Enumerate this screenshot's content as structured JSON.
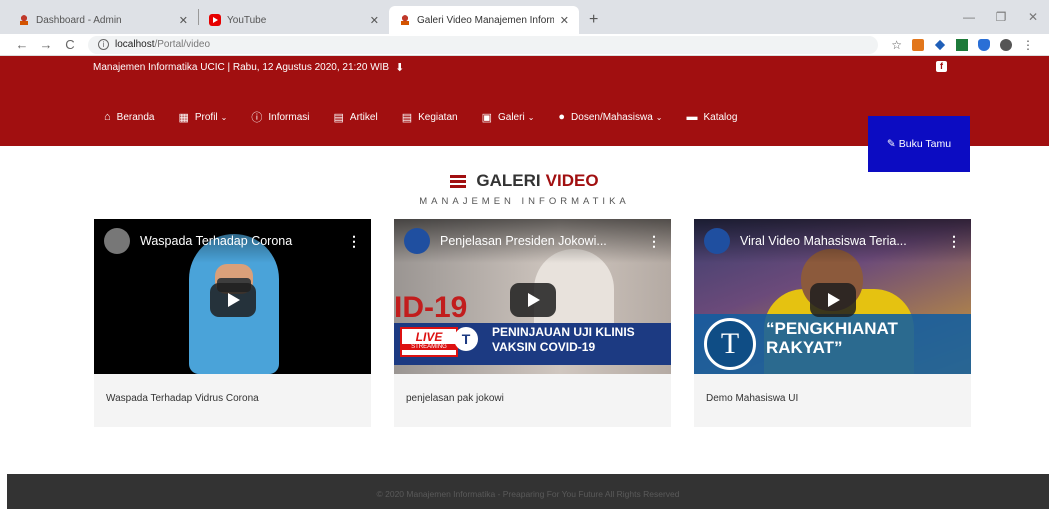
{
  "browser": {
    "tabs": [
      {
        "title": "Dashboard - Admin",
        "icon": "site-logo-icon"
      },
      {
        "title": "YouTube",
        "icon": "youtube-icon"
      },
      {
        "title": "Galeri Video Manajemen Informa",
        "icon": "site-logo-icon",
        "active": true
      }
    ],
    "url_host": "localhost",
    "url_path": "/Portal/video"
  },
  "header": {
    "topline": "Manajemen Informatika UCIC | Rabu, 12 Agustus 2020, 21:20 WIB",
    "menu": [
      {
        "label": "Beranda",
        "icon": "home-icon"
      },
      {
        "label": "Profil",
        "icon": "building-icon",
        "dropdown": true
      },
      {
        "label": "Informasi",
        "icon": "info-icon"
      },
      {
        "label": "Artikel",
        "icon": "newspaper-icon"
      },
      {
        "label": "Kegiatan",
        "icon": "newspaper-icon"
      },
      {
        "label": "Galeri",
        "icon": "image-icon",
        "dropdown": true
      },
      {
        "label": "Dosen/Mahasiswa",
        "icon": "user-icon",
        "dropdown": true
      },
      {
        "label": "Katalog",
        "icon": "folder-icon"
      }
    ],
    "guest_button": "Buku Tamu",
    "brand_color": "#a10f10",
    "guest_color": "#0c0cc2"
  },
  "section": {
    "title_main": "GALERI",
    "title_accent": "VIDEO",
    "subtitle": "MANAJEMEN INFORMATIKA"
  },
  "videos": [
    {
      "video_title": "Waspada Terhadap Corona",
      "caption": "Waspada Terhadap Vidrus Corona"
    },
    {
      "video_title": "Penjelasan Presiden Jokowi...",
      "caption": "penjelasan pak jokowi",
      "overlay_big": "ID-19",
      "overlay_live": "LIVE",
      "overlay_streaming": "STREAMING",
      "overlay_line1": "PENINJAUAN UJI KLINIS",
      "overlay_line2": "VAKSIN COVID-19"
    },
    {
      "video_title": "Viral Video Mahasiswa Teria...",
      "caption": "Demo Mahasiswa UI",
      "overlay_quote_1": "“PENGKHIANAT",
      "overlay_quote_2": "RAKYAT”"
    }
  ],
  "footer": {
    "text": "© 2020 Manajemen Informatika - Preaparing For You Future All Rights Reserved"
  }
}
